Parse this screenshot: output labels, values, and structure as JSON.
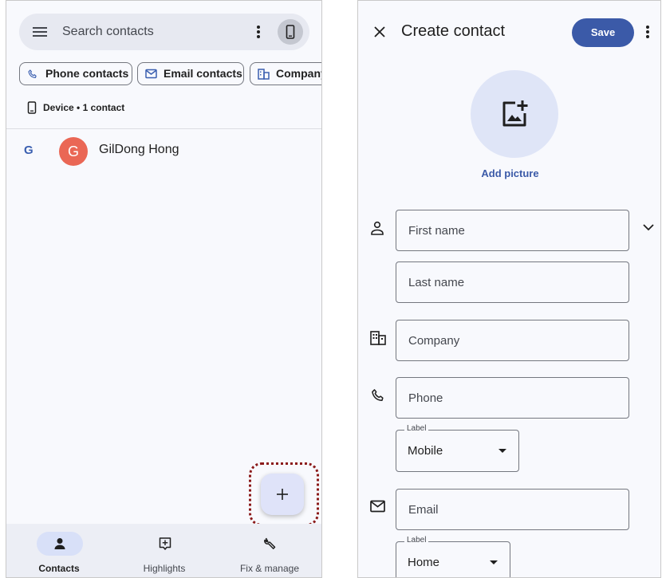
{
  "contacts_screen": {
    "search": {
      "placeholder": "Search contacts",
      "menu_icon": "hamburger-menu-icon",
      "more_icon": "more-vert-icon",
      "account_icon": "phone-device-icon"
    },
    "filters": [
      {
        "label": "Phone contacts",
        "icon": "phone-icon"
      },
      {
        "label": "Email contacts",
        "icon": "email-icon"
      },
      {
        "label": "Company",
        "icon": "building-icon"
      }
    ],
    "device_summary": "Device • 1 contact",
    "section_letter": "G",
    "contacts": [
      {
        "initial": "G",
        "name": "GilDong Hong",
        "avatar_color": "#ea6755"
      }
    ],
    "fab": {
      "icon": "plus-icon",
      "highlight_color": "#8b1a1a"
    },
    "bottom_nav": [
      {
        "label": "Contacts",
        "icon": "person-icon",
        "selected": true
      },
      {
        "label": "Highlights",
        "icon": "highlights-icon",
        "selected": false
      },
      {
        "label": "Fix & manage",
        "icon": "wrench-icon",
        "selected": false
      }
    ]
  },
  "create_contact_screen": {
    "title": "Create contact",
    "save_label": "Save",
    "add_picture_label": "Add picture",
    "fields": {
      "first_name": "First name",
      "last_name": "Last name",
      "company": "Company",
      "phone": "Phone",
      "email": "Email"
    },
    "phone_label": {
      "legend": "Label",
      "value": "Mobile"
    },
    "email_label": {
      "legend": "Label",
      "value": "Home"
    },
    "colors": {
      "accent": "#3b5aa8",
      "surface": "#f8f9fd",
      "avatar_bg": "#dfe5f7"
    }
  }
}
